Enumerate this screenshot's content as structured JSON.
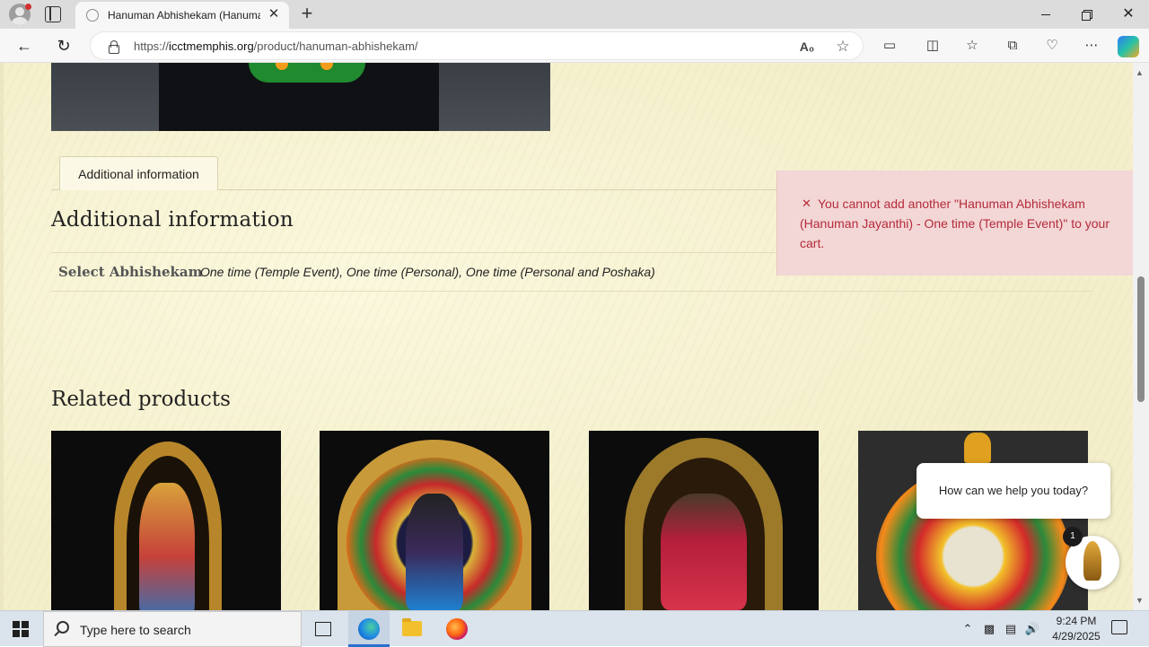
{
  "browser": {
    "tab_title": "Hanuman Abhishekam (Hanuman Jayanthi) – ICCT Memphis",
    "tab_close": "✕",
    "new_tab": "+",
    "url_prefix": "https://",
    "url_host": "icctmemphis.org",
    "url_path": "/product/hanuman-abhishekam/",
    "close_window": "✕"
  },
  "page": {
    "active_tab_label": "Additional information",
    "section_heading": "Additional information",
    "attributes": [
      {
        "label": "Select Abhishekam",
        "value": "One time (Temple Event), One time (Personal), One time (Personal and Poshaka)"
      }
    ],
    "related_heading": "Related products"
  },
  "notice": {
    "icon": "✕",
    "message": "You cannot add another \"Hanuman Abhishekam (Hanuman Jayanthi) - One time (Temple Event)\" to your cart."
  },
  "chat": {
    "prompt": "How can we help you today?",
    "unread_count": "1"
  },
  "taskbar": {
    "search_placeholder": "Type here to search",
    "time": "9:24 PM",
    "date": "4/29/2025"
  },
  "colors": {
    "page_background": "#f4efcb",
    "notice_background": "#f3d6d6",
    "notice_text": "#b42c3a"
  }
}
